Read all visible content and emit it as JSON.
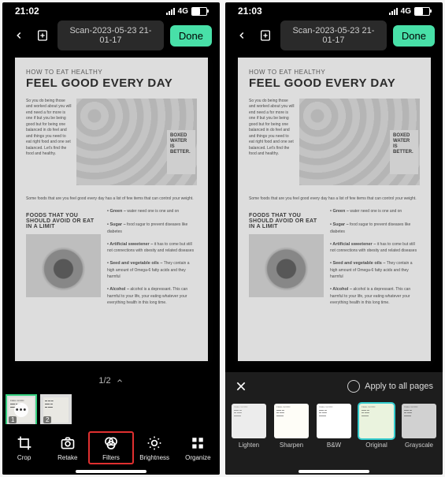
{
  "left": {
    "status_time": "21:02",
    "network_label": "4G",
    "doc_title": "Scan-2023-05-23 21-01-17",
    "done_label": "Done",
    "page_indicator": "1/2",
    "thumbs": [
      {
        "num": "1",
        "active": true,
        "has_menu": true
      },
      {
        "num": "2",
        "active": false,
        "has_menu": false
      }
    ],
    "bottom_bar": {
      "crop": "Crop",
      "retake": "Retake",
      "filters": "Filters",
      "brightness": "Brightness",
      "organize": "Organize"
    }
  },
  "right": {
    "status_time": "21:03",
    "network_label": "4G",
    "doc_title": "Scan-2023-05-23 21-01-17",
    "done_label": "Done",
    "apply_all_label": "Apply to all pages",
    "filters": {
      "lighten": "Lighten",
      "sharpen": "Sharpen",
      "bw": "B&W",
      "original": "Original",
      "grayscale": "Grayscale"
    }
  },
  "document": {
    "subheading": "HOW TO EAT HEALTHY",
    "headline": "FEEL GOOD EVERY DAY",
    "boxed_water": "BOXED WATER IS BETTER.",
    "section2": "FOODS THAT YOU SHOULD AVOID OR EAT IN A LIMIT"
  }
}
